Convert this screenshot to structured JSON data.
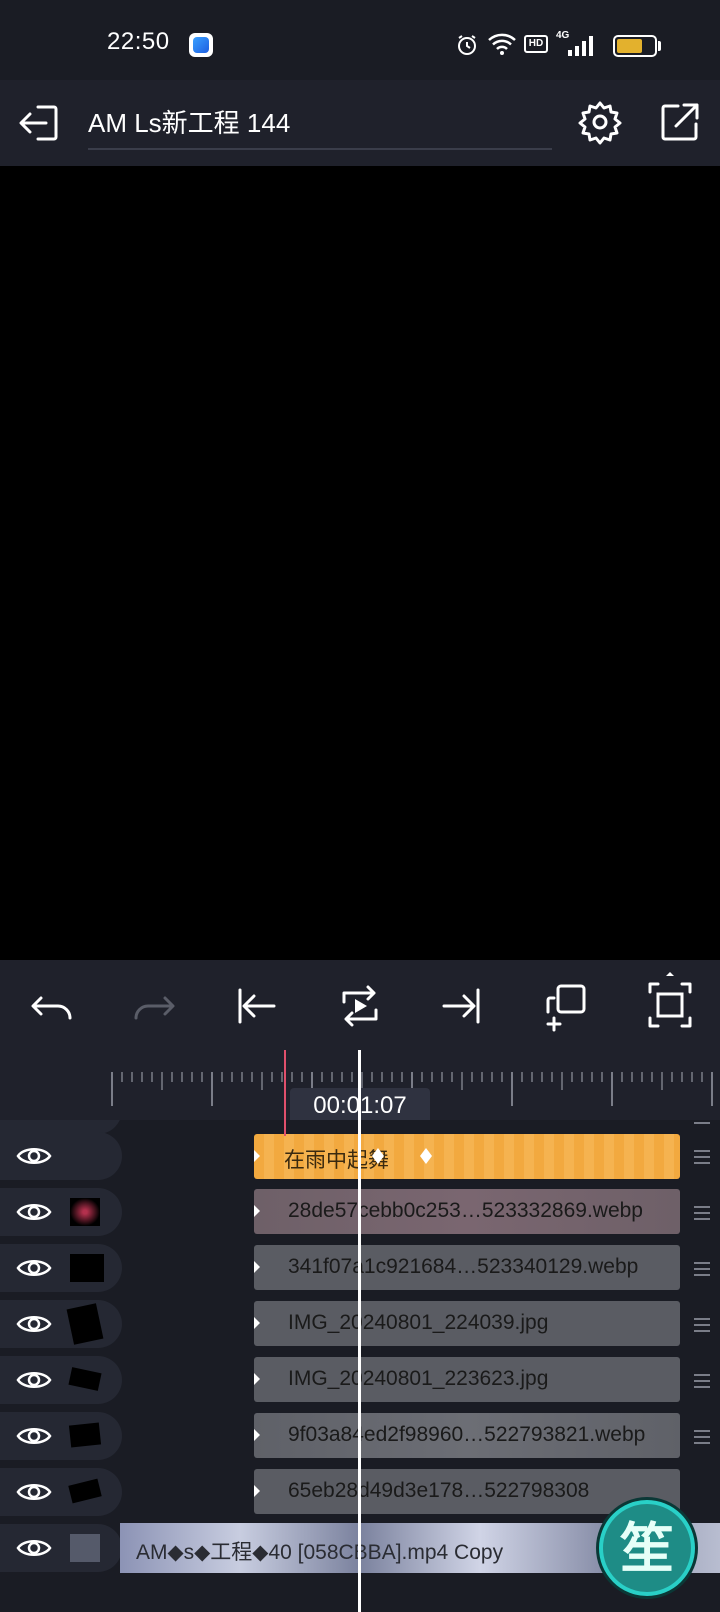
{
  "status_bar": {
    "time": "22:50",
    "icons": [
      "alarm-icon",
      "wifi-icon",
      "hd-icon",
      "signal-4g-icon"
    ],
    "hd_label": "HD",
    "net_label": "4G",
    "battery_level": 0.7,
    "battery_color": "#e3b12d"
  },
  "header": {
    "title": "AM Ls新工程 144",
    "icons": [
      "back-exit-icon",
      "gear-icon",
      "export-icon"
    ]
  },
  "toolbar": {
    "icons": [
      "undo-icon",
      "redo-icon",
      "jump-start-icon",
      "loop-play-icon",
      "jump-end-icon",
      "duplicate-icon",
      "fullscreen-icon"
    ]
  },
  "timeline": {
    "timecode": "00:01:07"
  },
  "tracks": [
    {
      "label": "在雨中起舞",
      "type": "text"
    },
    {
      "label": "28de57cebb0c253…523332869.webp",
      "type": "image"
    },
    {
      "label": "341f07a1c921684…523340129.webp",
      "type": "image"
    },
    {
      "label": "IMG_20240801_224039.jpg",
      "type": "image"
    },
    {
      "label": "IMG_20240801_223623.jpg",
      "type": "image"
    },
    {
      "label": "9f03a84ed2f98960…522793821.webp",
      "type": "image"
    },
    {
      "label": "65eb28d49d3e178…522798308",
      "type": "image"
    },
    {
      "label": "AM◆s◆工程◆40 [058CBBA].mp4 Copy",
      "type": "video"
    }
  ],
  "fab": {
    "label": "笙",
    "accent": "#29d0c7"
  },
  "colors": {
    "background": "#1a1c24",
    "text_clip": "#f2a93f",
    "playhead": "#ffffff",
    "marker": "#e0506c"
  }
}
